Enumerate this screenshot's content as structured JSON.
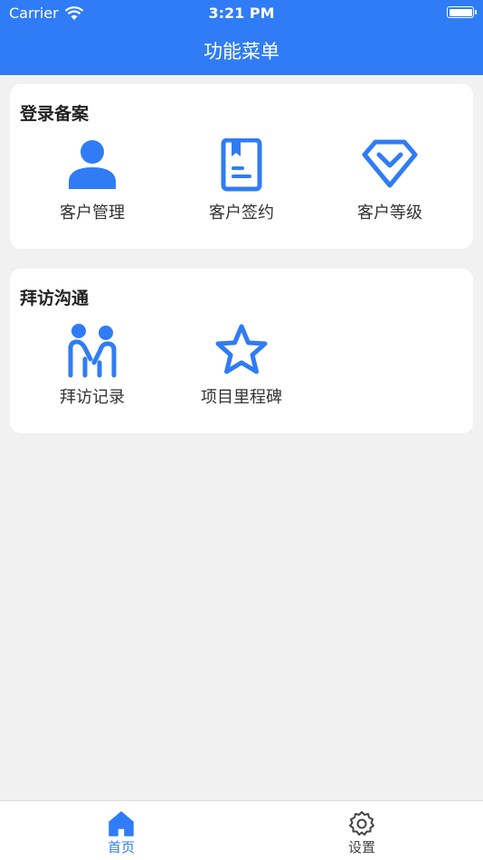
{
  "status_bar": {
    "carrier": "Carrier",
    "time": "3:21 PM"
  },
  "header": {
    "title": "功能菜单"
  },
  "sections": [
    {
      "title": "登录备案",
      "items": [
        {
          "label": "客户管理",
          "icon": "person-icon"
        },
        {
          "label": "客户签约",
          "icon": "contract-book-icon"
        },
        {
          "label": "客户等级",
          "icon": "diamond-level-icon"
        }
      ]
    },
    {
      "title": "拜访沟通",
      "items": [
        {
          "label": "拜访记录",
          "icon": "visit-people-icon"
        },
        {
          "label": "项目里程碑",
          "icon": "star-icon"
        }
      ]
    }
  ],
  "tabbar": {
    "tabs": [
      {
        "label": "首页",
        "icon": "home-icon",
        "active": true
      },
      {
        "label": "设置",
        "icon": "gear-icon",
        "active": false
      }
    ]
  },
  "colors": {
    "accent": "#2f7cf6",
    "background": "#f1f1f1",
    "inactive": "#444444"
  }
}
